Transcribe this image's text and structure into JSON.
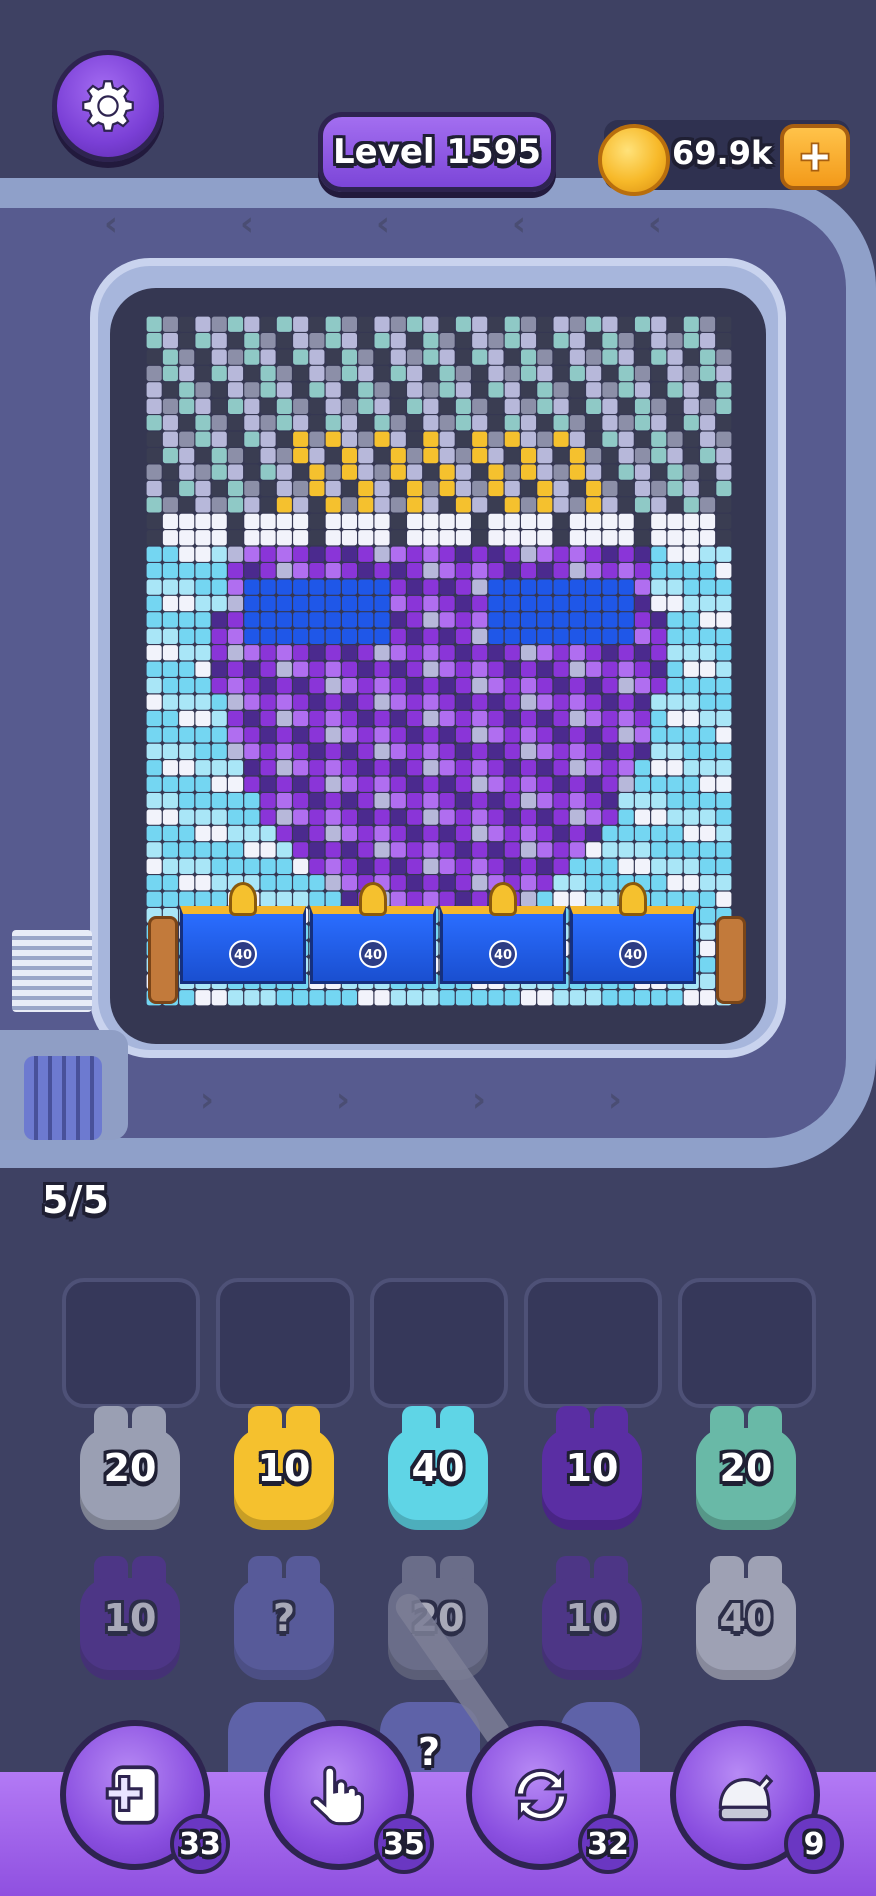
{
  "header": {
    "level_label": "Level 1595",
    "coins": "69.9k",
    "icons": {
      "settings": "gear-icon",
      "coin": "coin-icon",
      "add": "plus-icon"
    }
  },
  "board": {
    "gates": [
      {
        "value": "40"
      },
      {
        "value": "40"
      },
      {
        "value": "40"
      },
      {
        "value": "40"
      }
    ]
  },
  "dock": {
    "counter": "5/5"
  },
  "blocks_row1": [
    {
      "value": "20",
      "color": "#9a9fb3"
    },
    {
      "value": "10",
      "color": "#f5c12e"
    },
    {
      "value": "40",
      "color": "#5fd5e6"
    },
    {
      "value": "10",
      "color": "#5a2ea3"
    },
    {
      "value": "20",
      "color": "#69b9a7"
    }
  ],
  "blocks_row2": [
    {
      "value": "10",
      "color": "#5a2ea3"
    },
    {
      "value": "?",
      "color": "#6c70c6"
    },
    {
      "value": "20",
      "color": "#8e91a8"
    },
    {
      "value": "10",
      "color": "#5a2ea3"
    },
    {
      "value": "40",
      "color": "#eef0f7"
    }
  ],
  "row3_hint": "?",
  "boosters": [
    {
      "icon": "add-slot-icon",
      "count": "33"
    },
    {
      "icon": "hand-tap-icon",
      "count": "35"
    },
    {
      "icon": "shuffle-icon",
      "count": "32"
    },
    {
      "icon": "vacuum-icon",
      "count": "9"
    }
  ],
  "colors": {
    "background": "#3e4163",
    "accent_purple": "#8a4fe0",
    "gate_blue": "#2a6dff"
  }
}
